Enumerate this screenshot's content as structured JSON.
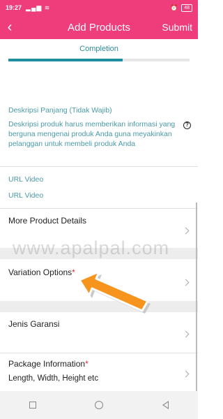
{
  "status_bar": {
    "time": "19:27",
    "battery": "48"
  },
  "header": {
    "back_icon": "chevron-left-icon",
    "title": "Add Products",
    "submit_label": "Submit",
    "bg_color": "#ef3c7a"
  },
  "progress": {
    "label": "Completion",
    "fraction": 0.63,
    "color": "#1f8fa0"
  },
  "description": {
    "title": "Deskripsi Panjang (Tidak Wajib)",
    "text": "Deskripsi produk harus memberikan informasi yang berguna mengenai produk Anda guna meyakinkan pelanggan untuk membeli produk Anda",
    "help_icon": "question-circle-icon"
  },
  "url_video": {
    "label": "URL Video",
    "placeholder": "URL Video"
  },
  "rows": {
    "more_details": {
      "label": "More Product Details"
    },
    "variation": {
      "label": "Variation Options",
      "required": "*"
    },
    "garansi": {
      "label": "Jenis Garansi"
    },
    "package": {
      "label": "Package Information",
      "required": "*",
      "value": "Length, Width, Height etc"
    }
  },
  "watermark": "www.apalpal.com"
}
